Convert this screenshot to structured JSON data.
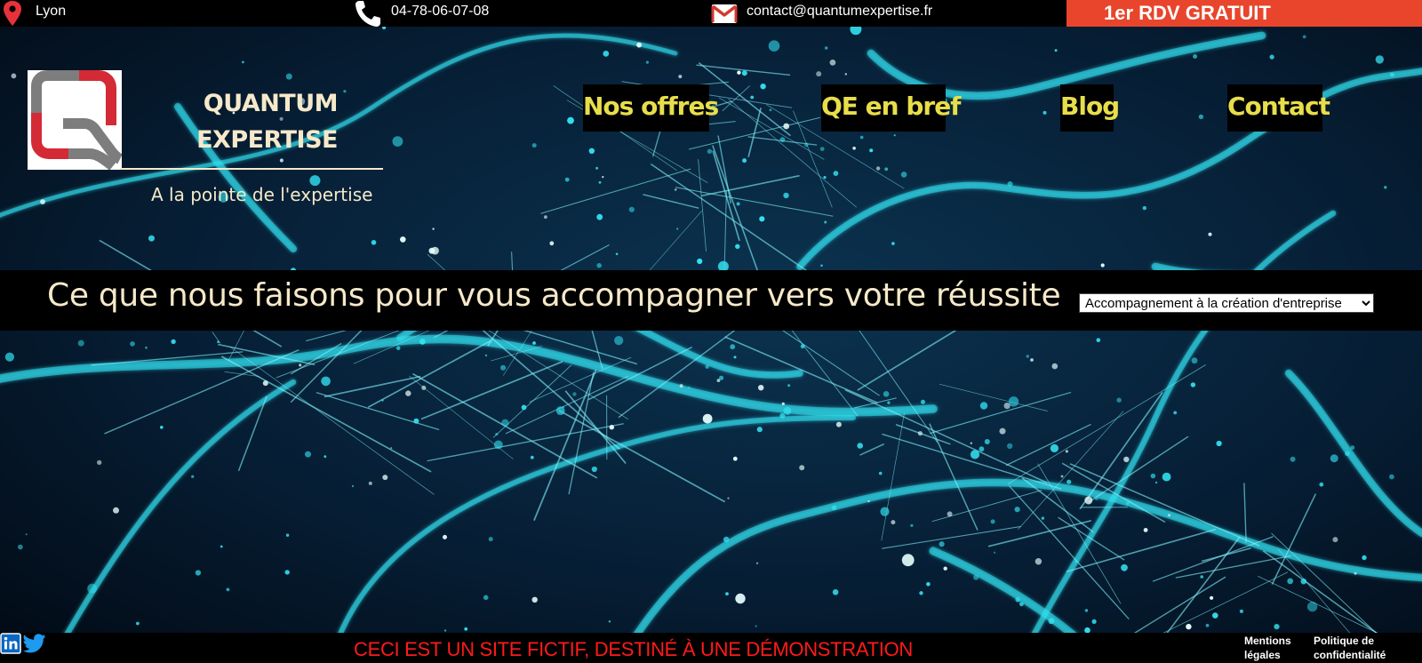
{
  "topbar": {
    "location": "Lyon",
    "phone": "04-78-06-07-08",
    "email": "contact@quantumexpertise.fr",
    "cta": "1er RDV GRATUIT",
    "icons": [
      "map-pin-icon",
      "phone-icon",
      "mail-icon"
    ]
  },
  "brand": {
    "line1": "QUANTUM",
    "line2": "EXPERTISE",
    "tagline": "A la pointe de l'expertise"
  },
  "nav": {
    "offres": "Nos offres",
    "qe": "QE en bref",
    "blog": "Blog",
    "contact": "Contact"
  },
  "band": {
    "title": "Ce que nous faisons pour vous accompagner vers votre réussite",
    "select_value": "Accompagnement à la création d'entreprise"
  },
  "footer": {
    "demo": "CECI EST UN SITE FICTIF, DESTINÉ À UNE DÉMONSTRATION",
    "legal_line1": "Mentions",
    "legal_line2": "légales",
    "privacy_line1": "Politique de",
    "privacy_line2": "confidentialité",
    "icons": [
      "linkedin-icon",
      "twitter-icon"
    ]
  },
  "colors": {
    "accent": "#e8452c",
    "nav_text": "#e8de4a",
    "brand_text": "#f6e9c9",
    "demo_text": "#ff1a1a",
    "network": "#32e0f0",
    "background": "#04182a"
  }
}
